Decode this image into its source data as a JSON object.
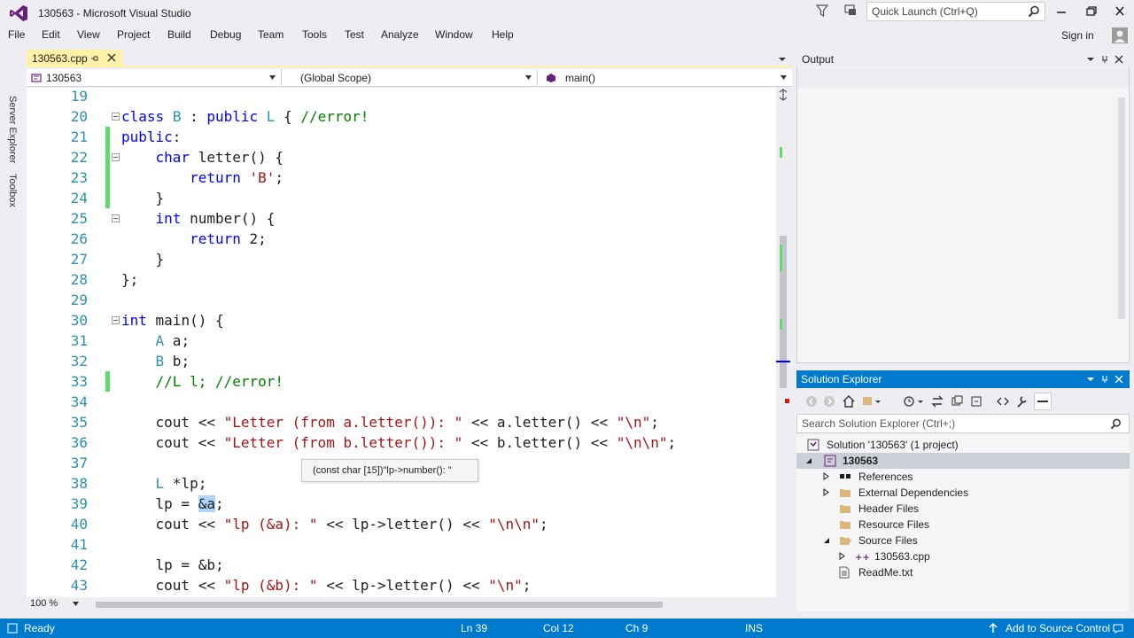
{
  "window": {
    "title": "130563 - Microsoft Visual Studio",
    "quick_launch_placeholder": "Quick Launch (Ctrl+Q)",
    "sign_in": "Sign in"
  },
  "menu": [
    "File",
    "Edit",
    "View",
    "Project",
    "Build",
    "Debug",
    "Team",
    "Tools",
    "Test",
    "Analyze",
    "Window",
    "Help"
  ],
  "side_tabs": [
    "Server Explorer",
    "Toolbox"
  ],
  "document_tab": {
    "label": "130563.cpp"
  },
  "navigation": {
    "project": "130563",
    "scope": "(Global Scope)",
    "member": "main()"
  },
  "code_lines": [
    {
      "n": "19",
      "t": ""
    },
    {
      "n": "20",
      "t": "class B : public L { //error!"
    },
    {
      "n": "21",
      "t": "public:"
    },
    {
      "n": "22",
      "t": "    char letter() {"
    },
    {
      "n": "23",
      "t": "        return 'B';"
    },
    {
      "n": "24",
      "t": "    }"
    },
    {
      "n": "25",
      "t": "    int number() {"
    },
    {
      "n": "26",
      "t": "        return 2;"
    },
    {
      "n": "27",
      "t": "    }"
    },
    {
      "n": "28",
      "t": "};"
    },
    {
      "n": "29",
      "t": ""
    },
    {
      "n": "30",
      "t": "int main() {"
    },
    {
      "n": "31",
      "t": "    A a;"
    },
    {
      "n": "32",
      "t": "    B b;"
    },
    {
      "n": "33",
      "t": "    //L l; //error!"
    },
    {
      "n": "34",
      "t": ""
    },
    {
      "n": "35",
      "t": "    cout << \"Letter (from a.letter()): \" << a.letter() << \"\\n\";"
    },
    {
      "n": "36",
      "t": "    cout << \"Letter (from b.letter()): \" << b.letter() << \"\\n\\n\";"
    },
    {
      "n": "37",
      "t": ""
    },
    {
      "n": "38",
      "t": "    L *lp;"
    },
    {
      "n": "39",
      "t": "    lp = &a;"
    },
    {
      "n": "40",
      "t": "    cout << \"lp (&a): \" << lp->letter() << \"\\n\\n\";"
    },
    {
      "n": "41",
      "t": ""
    },
    {
      "n": "42",
      "t": "    lp = &b;"
    },
    {
      "n": "43",
      "t": "    cout << \"lp (&b): \" << lp->letter() << \"\\n\";"
    }
  ],
  "tooltip": "(const char [15])\"lp->number(): \"",
  "zoom": "100 %",
  "output": {
    "title": "Output"
  },
  "solution_explorer": {
    "title": "Solution Explorer",
    "search_placeholder": "Search Solution Explorer (Ctrl+;)",
    "items": [
      "Solution '130563' (1 project)",
      "130563",
      "References",
      "External Dependencies",
      "Header Files",
      "Resource Files",
      "Source Files",
      "130563.cpp",
      "ReadMe.txt"
    ]
  },
  "status": {
    "ready": "Ready",
    "ln": "Ln 39",
    "col": "Col 12",
    "ch": "Ch 9",
    "mode": "INS",
    "source_control": "Add to Source Control"
  }
}
